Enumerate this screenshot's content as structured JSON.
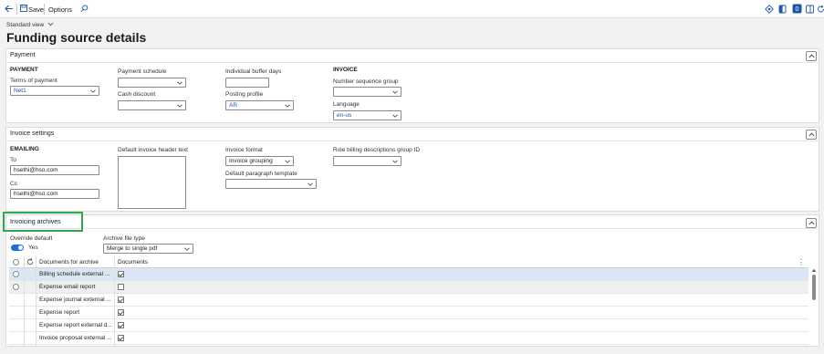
{
  "toolbar": {
    "save_label": "Save",
    "options_label": "Options"
  },
  "view": {
    "label": "Standard view"
  },
  "page_title": "Funding source details",
  "payment": {
    "title": "Payment",
    "group_payment": "PAYMENT",
    "terms_label": "Terms of payment",
    "terms_value": "Net1",
    "schedule_label": "Payment schedule",
    "schedule_value": "",
    "cash_label": "Cash discount",
    "cash_value": "",
    "buffer_label": "Individual buffer days",
    "buffer_value": "",
    "posting_label": "Posting profile",
    "posting_value": "AR",
    "group_invoice": "INVOICE",
    "numseq_label": "Number sequence group",
    "numseq_value": "",
    "lang_label": "Language",
    "lang_value": "en-us"
  },
  "invoice_settings": {
    "title": "Invoice settings",
    "group_emailing": "EMAILING",
    "to_label": "To",
    "to_value": "hsethi@hso.com",
    "cc_label": "Cc",
    "cc_value": "hsethi@hso.com",
    "header_text_label": "Default invoice header text",
    "format_label": "Invoice format",
    "format_value": "Invoice grouping",
    "paragraph_label": "Default paragraph template",
    "paragraph_value": "",
    "role_label": "Role billing descriptions group ID",
    "role_value": ""
  },
  "invoicing_archives": {
    "title": "Invoicing archives",
    "override_label": "Override default",
    "override_value": "Yes",
    "override_on": true,
    "archive_type_label": "Archive file type",
    "archive_type_value": "Merge to single pdf",
    "columns": [
      "Documents for archive",
      "Documents"
    ],
    "rows": [
      {
        "name": "Billing schedule external ...",
        "checked": true,
        "selected": true,
        "radio": true
      },
      {
        "name": "Expense email report",
        "checked": false,
        "selected": false,
        "radio": true
      },
      {
        "name": "Expense journal external ...",
        "checked": true,
        "selected": false,
        "radio": false
      },
      {
        "name": "Expense report",
        "checked": true,
        "selected": false,
        "radio": false
      },
      {
        "name": "Expense report external d...",
        "checked": true,
        "selected": false,
        "radio": false
      },
      {
        "name": "Invoice proposal external ...",
        "checked": true,
        "selected": false,
        "radio": false
      }
    ]
  },
  "colors": {
    "accent": "#1d6fd6",
    "highlight_box": "#2fa84f",
    "selected_row": "#dbe6f5",
    "hover_row": "#efefef"
  }
}
